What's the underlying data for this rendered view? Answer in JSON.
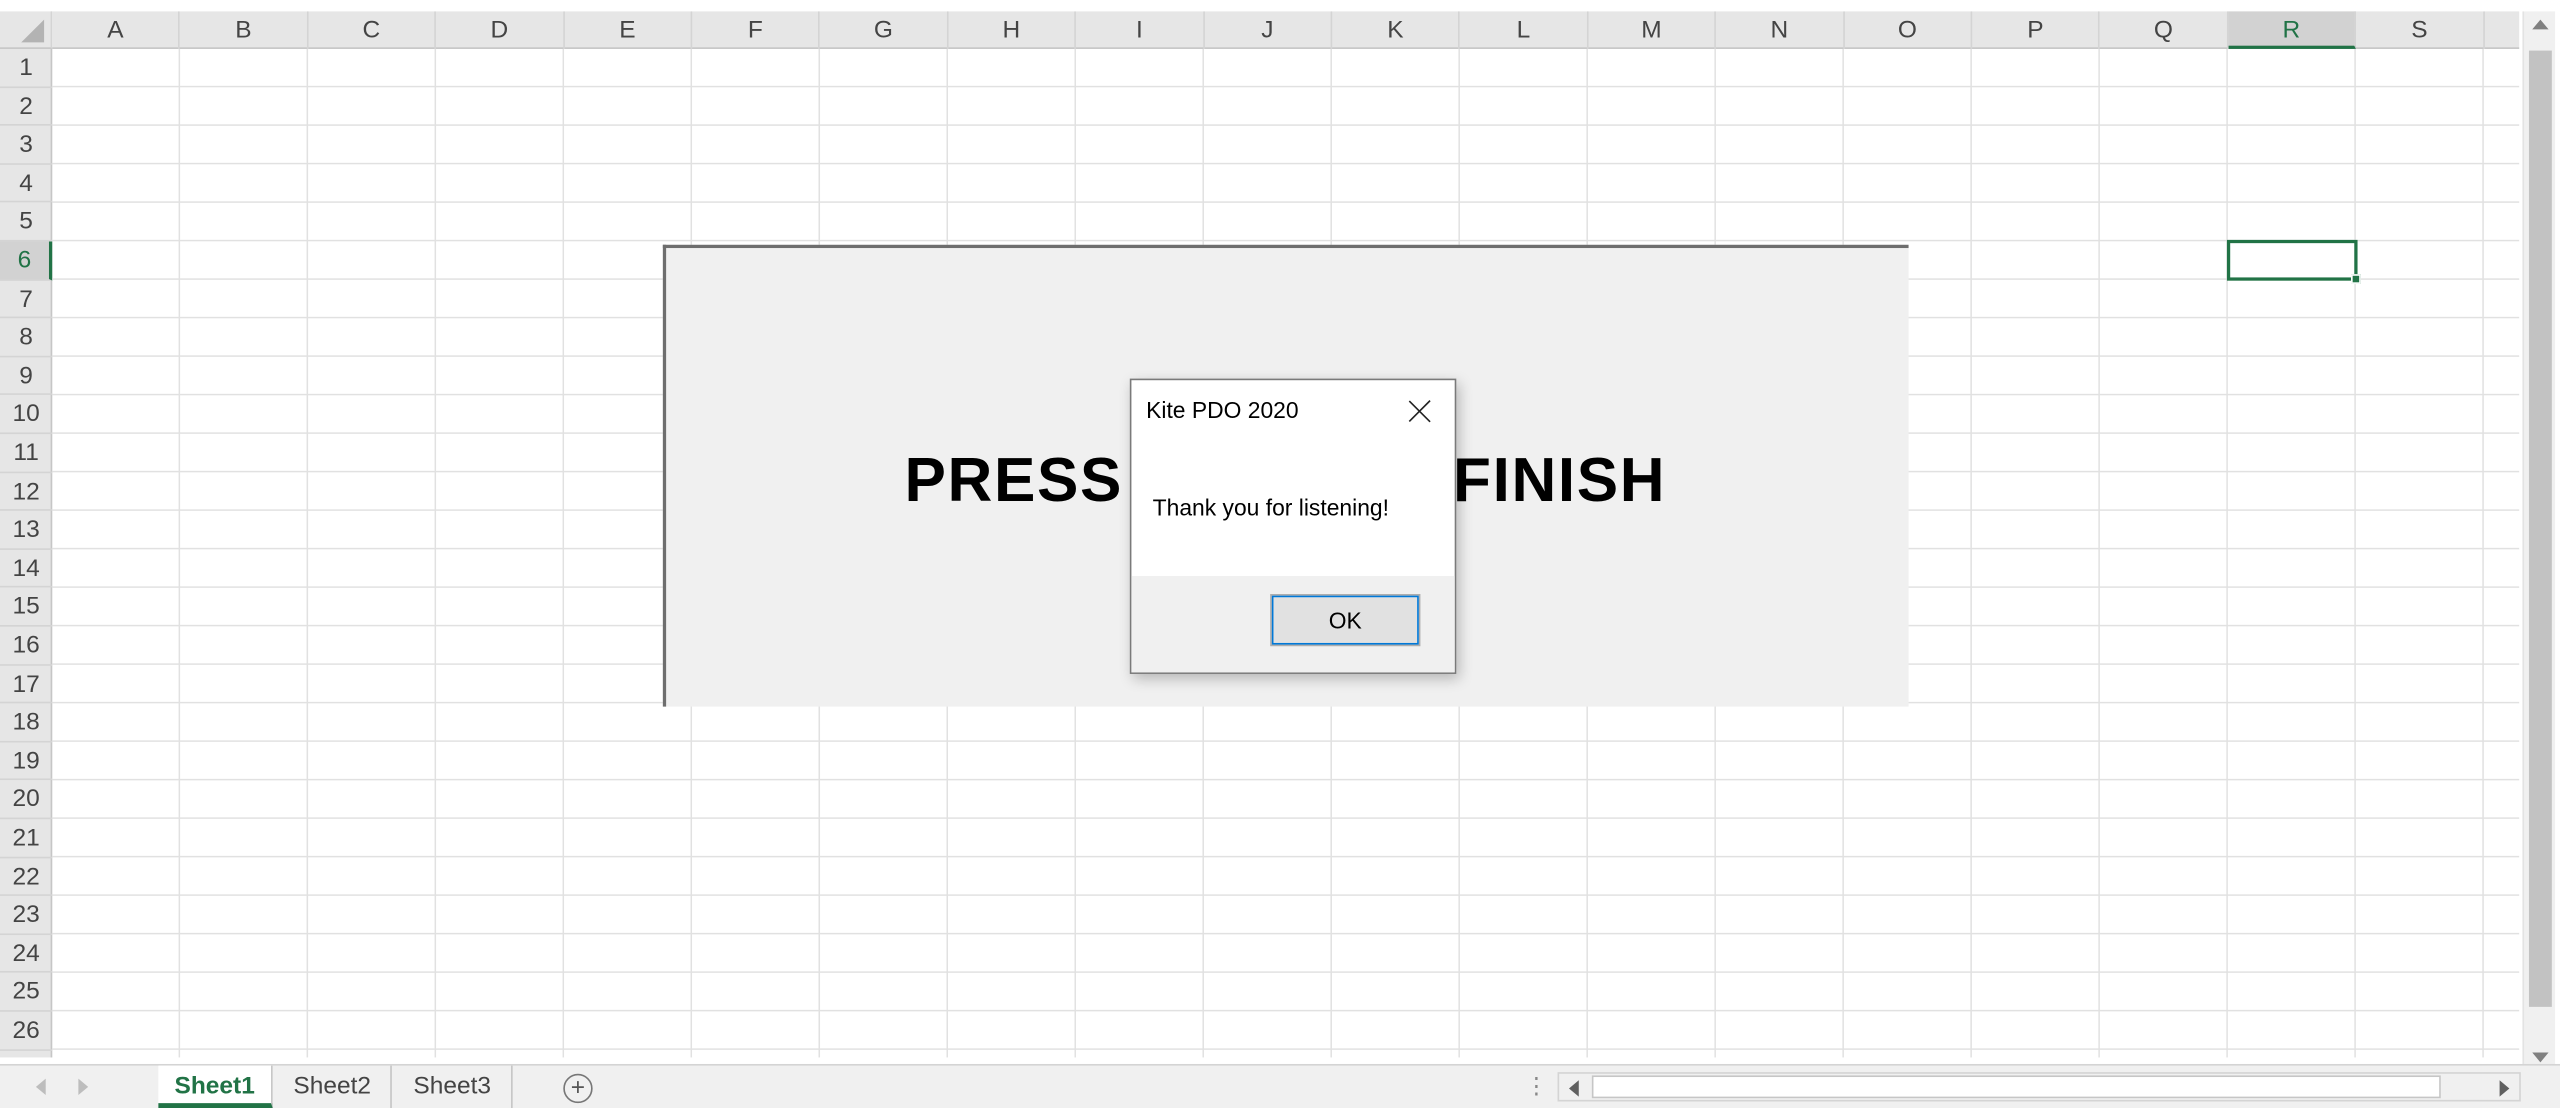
{
  "grid": {
    "columns": [
      "A",
      "B",
      "C",
      "D",
      "E",
      "F",
      "G",
      "H",
      "I",
      "J",
      "K",
      "L",
      "M",
      "N",
      "O",
      "P",
      "Q",
      "R",
      "S"
    ],
    "rows": [
      "1",
      "2",
      "3",
      "4",
      "5",
      "6",
      "7",
      "8",
      "9",
      "10",
      "11",
      "12",
      "13",
      "14",
      "15",
      "16",
      "17",
      "18",
      "19",
      "20",
      "21",
      "22",
      "23",
      "24",
      "25",
      "26"
    ],
    "active_column": "R",
    "active_row": "6"
  },
  "shape": {
    "text_left": "PRESS",
    "text_right": "FINISH"
  },
  "dialog": {
    "title": "Kite PDO 2020",
    "message": "Thank you for listening!",
    "ok_label": "OK"
  },
  "sheets": {
    "tabs": [
      "Sheet1",
      "Sheet2",
      "Sheet3"
    ],
    "active": "Sheet1",
    "add_label": "+"
  },
  "colors": {
    "accent": "#217346",
    "header_bg": "#e6e6e6",
    "shape_bg": "#f0f0f0"
  }
}
